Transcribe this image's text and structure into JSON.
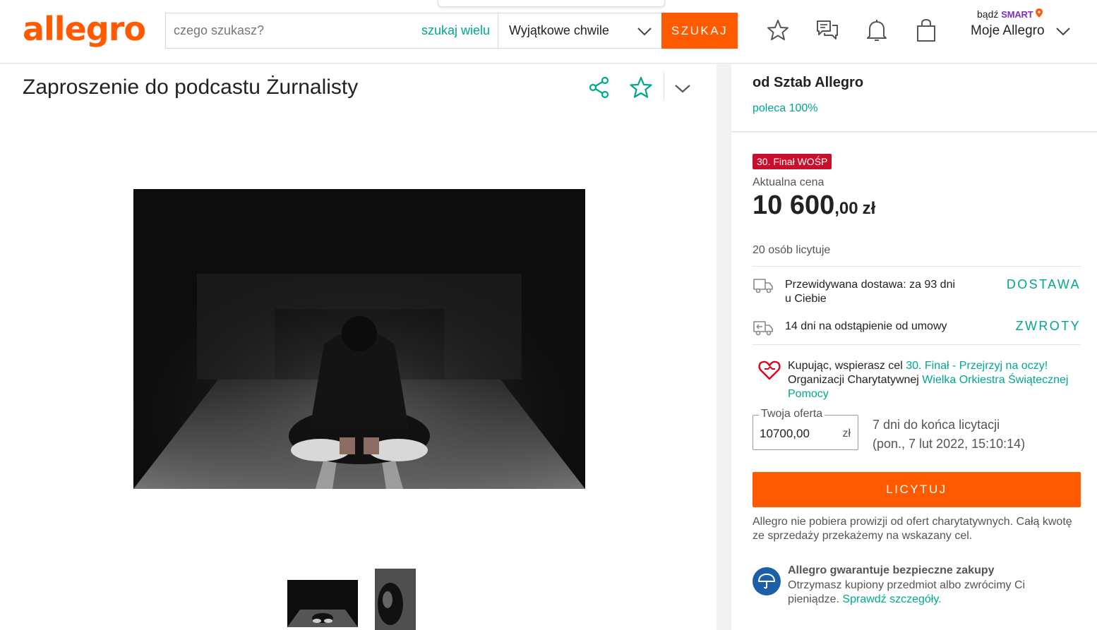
{
  "header": {
    "logo": "allegro",
    "search_placeholder": "czego szukasz?",
    "search_many": "szukaj wielu",
    "category": "Wyjątkowe chwile",
    "search_button": "SZUKAJ",
    "smart_prefix": "bądź",
    "smart_label": "SMART",
    "my_allegro": "Moje Allegro",
    "icons": [
      "star-icon",
      "chat-icon",
      "bell-icon",
      "cart-icon"
    ]
  },
  "offer": {
    "title": "Zaproszenie do podcastu Żurnalisty"
  },
  "seller": {
    "name": "od Sztab Allegro",
    "recommend": "poleca 100%"
  },
  "buy": {
    "badge": "30. Finał WOŚP",
    "price_label": "Aktualna cena",
    "price_int": "10 600",
    "price_dec": ",00",
    "price_currency": "zł",
    "bidders": "20 osób licytuje",
    "delivery_text_1": "Przewidywana dostawa: za 93 dni",
    "delivery_text_2": "u Ciebie",
    "delivery_link": "DOSTAWA",
    "returns_text": "14 dni na odstąpienie od umowy",
    "returns_link": "ZWROTY",
    "charity_prefix": "Kupując, wspierasz cel ",
    "charity_goal": "30. Finał - Przejrzyj na oczy!",
    "charity_mid": " Organizacji Charytatywnej ",
    "charity_org": "Wielka Orkiestra Świątecznej Pomocy",
    "offer_legend": "Twoja oferta",
    "offer_value": "10700,00",
    "offer_currency": "zł",
    "end_days": "7 dni do końca licytacji",
    "end_date": "(pon., 7 lut 2022, 15:10:14)",
    "bid_button": "LICYTUJ",
    "note": "Allegro nie pobiera prowizji od ofert charytatywnych. Całą kwotę ze sprzedaży przekażemy na wskazany cel.",
    "guarantee_title": "Allegro gwarantuje bezpieczne zakupy",
    "guarantee_text": "Otrzymasz kupiony przedmiot albo zwrócimy Ci pieniądze. ",
    "guarantee_link": "Sprawdź szczegóły."
  },
  "colors": {
    "brand": "#ff5a00",
    "link": "#00a790",
    "badge": "#c8102e",
    "smart": "#7c30bf"
  }
}
